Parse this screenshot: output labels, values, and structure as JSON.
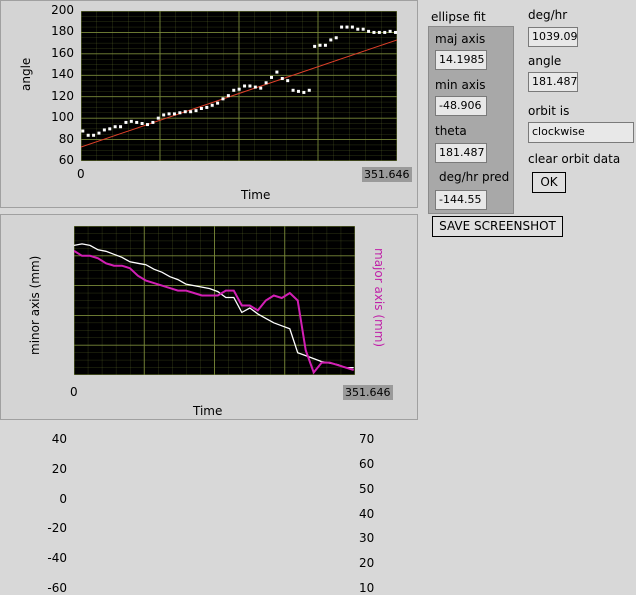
{
  "top_chart": {
    "ylabel": "angle",
    "xlabel": "Time",
    "y_ticks": [
      "200",
      "180",
      "160",
      "140",
      "120",
      "100",
      "80",
      "60"
    ],
    "x_start": "0",
    "x_end": "351.646"
  },
  "bottom_chart": {
    "ylabel_left": "minor axis (mm)",
    "ylabel_right": "major axis (mm)",
    "xlabel": "Time",
    "y_ticks_left": [
      "40",
      "20",
      "0",
      "-20",
      "-40",
      "-60"
    ],
    "y_ticks_right": [
      "70",
      "60",
      "50",
      "40",
      "30",
      "20",
      "10"
    ],
    "x_start": "0",
    "x_end": "351.646"
  },
  "ellipse_fit": {
    "title": "ellipse fit",
    "maj_axis_label": "maj axis",
    "maj_axis_value": "14.1985",
    "min_axis_label": "min axis",
    "min_axis_value": "-48.906",
    "theta_label": "theta",
    "theta_value": "181.487",
    "deg_hr_pred_label": "deg/hr pred",
    "deg_hr_pred_value": "-144.55"
  },
  "right_panel": {
    "deg_hr_label": "deg/hr",
    "deg_hr_value": "1039.09",
    "angle_label": "angle",
    "angle_value": "181.487",
    "orbit_label": "orbit is",
    "orbit_value": "clockwise",
    "clear_label": "clear orbit data",
    "ok_label": "OK"
  },
  "save_screenshot_label": "SAVE SCREENSHOT",
  "colors": {
    "plot_bg": "#000000",
    "grid": "#7a8a3a",
    "trace_white": "#ffffff",
    "trace_magenta": "#d21fb4",
    "fit_line": "#e0402a"
  },
  "chart_data": [
    {
      "type": "scatter",
      "xlabel": "Time",
      "ylabel": "angle",
      "xlim": [
        0,
        351.646
      ],
      "ylim": [
        60,
        200
      ],
      "grid": true,
      "series": [
        {
          "x": [
            2,
            8,
            14,
            20,
            26,
            32,
            38,
            44,
            50,
            56,
            62,
            68,
            74,
            80,
            86,
            92,
            98,
            104,
            110,
            116,
            122,
            128,
            134,
            140,
            146,
            152,
            158,
            164,
            170,
            176,
            182,
            188,
            194,
            200,
            206,
            212,
            218,
            224,
            230,
            236,
            242,
            248,
            254,
            260,
            266,
            272,
            278,
            284,
            290,
            296,
            302,
            308,
            314,
            320,
            326,
            332,
            338,
            344,
            350
          ],
          "y": [
            88,
            84,
            84,
            86,
            89,
            90,
            92,
            92,
            96,
            97,
            96,
            95,
            94,
            96,
            100,
            103,
            104,
            104,
            105,
            106,
            106,
            107,
            109,
            110,
            112,
            114,
            118,
            121,
            126,
            127,
            130,
            130,
            129,
            128,
            133,
            138,
            143,
            137,
            135,
            126,
            125,
            124,
            126,
            167,
            168,
            168,
            173,
            175,
            185,
            185,
            185,
            183,
            183,
            181,
            180,
            180,
            180,
            181,
            180
          ]
        },
        {
          "x": [
            0,
            351.646
          ],
          "y": [
            73,
            173
          ]
        }
      ]
    },
    {
      "type": "line",
      "xlabel": "Time",
      "xlim": [
        0,
        351.646
      ],
      "grid": true,
      "series": [
        {
          "axis": "left",
          "ylim": [
            -60,
            40
          ],
          "x": [
            0,
            10,
            20,
            30,
            40,
            50,
            60,
            70,
            80,
            90,
            100,
            110,
            120,
            130,
            140,
            150,
            160,
            170,
            180,
            190,
            200,
            210,
            220,
            230,
            240,
            250,
            260,
            270,
            280,
            290,
            300,
            310,
            320,
            330,
            340,
            350
          ],
          "y": [
            27,
            28,
            27,
            24,
            23,
            21,
            19,
            16,
            15,
            14,
            11,
            9,
            6,
            4,
            1,
            0,
            -1,
            -2,
            -4,
            -8,
            -8,
            -18,
            -15,
            -19,
            -22,
            -25,
            -27,
            -29,
            -45,
            -47,
            -49,
            -51,
            -52,
            -53,
            -55,
            -55
          ]
        },
        {
          "axis": "right",
          "ylim": [
            10,
            70
          ],
          "x": [
            0,
            10,
            20,
            30,
            40,
            50,
            60,
            70,
            80,
            90,
            100,
            110,
            120,
            130,
            140,
            150,
            160,
            170,
            180,
            190,
            200,
            210,
            220,
            230,
            240,
            250,
            260,
            270,
            280,
            290,
            300,
            310,
            320,
            330,
            340,
            350
          ],
          "y": [
            60,
            58,
            58,
            57,
            55,
            54,
            54,
            53,
            50,
            48,
            47,
            46,
            45,
            44,
            44,
            43,
            42,
            42,
            42,
            44,
            44,
            38,
            38,
            36,
            40,
            42,
            41,
            43,
            40,
            20,
            11,
            15,
            15,
            14,
            13,
            12
          ]
        }
      ]
    }
  ]
}
